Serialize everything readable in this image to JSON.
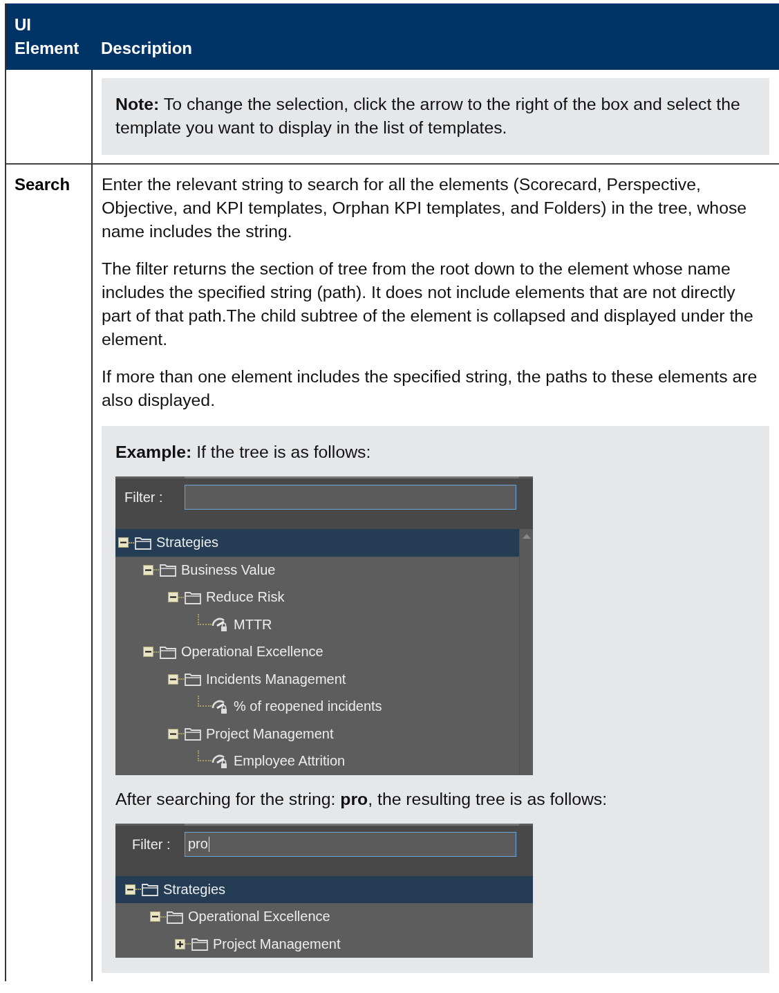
{
  "table": {
    "columns": [
      "UI Element",
      "Description"
    ],
    "rows": [
      {
        "blocks": [
          {
            "kind": "note",
            "text": "**Note:** To change the selection, click the arrow to the right of the box and select the template you want to display in the list of templates."
          }
        ]
      },
      {
        "element": "Search",
        "blocks": [
          {
            "kind": "paragraph",
            "text": "Enter the relevant string to search for all the elements (Scorecard, Perspective, Objective, and KPI templates, Orphan KPI templates, and Folders) in the tree, whose name includes the string."
          },
          {
            "kind": "paragraph",
            "text": "The filter returns the section of tree from the root down to the element whose name includes the specified string (path). It does not include elements that are not directly part of that path.The child subtree of the element is collapsed and displayed under the element."
          },
          {
            "kind": "paragraph",
            "text": "If more than one element includes the specified string, the paths to these elements are also displayed."
          },
          {
            "kind": "example",
            "parts": [
              {
                "kind": "text",
                "text": "**Example:** If the tree is as follows:"
              },
              {
                "kind": "tree",
                "filter_label": "Filter :",
                "scrollbar": true,
                "nodes": [
                  {
                    "label": "Strategies",
                    "kind": "folder",
                    "expanded": true,
                    "selected": true,
                    "children": [
                      {
                        "label": "Business Value",
                        "kind": "folder",
                        "expanded": true,
                        "selected": false,
                        "children": [
                          {
                            "label": "Reduce Risk",
                            "kind": "folder",
                            "expanded": true,
                            "selected": false,
                            "children": [
                              {
                                "label": "MTTR",
                                "kind": "kpi",
                                "selected": false
                              }
                            ]
                          }
                        ]
                      },
                      {
                        "label": "Operational Excellence",
                        "kind": "folder",
                        "expanded": true,
                        "selected": false,
                        "children": [
                          {
                            "label": "Incidents Management",
                            "kind": "folder",
                            "expanded": true,
                            "selected": false,
                            "children": [
                              {
                                "label": "% of reopened incidents",
                                "kind": "kpi",
                                "selected": false
                              }
                            ]
                          },
                          {
                            "label": "Project Management",
                            "kind": "folder",
                            "expanded": true,
                            "selected": false,
                            "children": [
                              {
                                "label": "Employee Attrition",
                                "kind": "kpi",
                                "selected": false
                              }
                            ]
                          }
                        ]
                      }
                    ]
                  }
                ]
              },
              {
                "kind": "text",
                "text": "After searching for the string: **pro**, the resulting tree is as follows:"
              },
              {
                "kind": "tree",
                "filter_label": "Filter :",
                "filter_value": "pro",
                "scrollbar": false,
                "nodes": [
                  {
                    "label": "Strategies",
                    "kind": "folder",
                    "expanded": true,
                    "selected": true,
                    "children": [
                      {
                        "label": "Operational Excellence",
                        "kind": "folder",
                        "expanded": true,
                        "selected": false,
                        "children": [
                          {
                            "label": "Project Management",
                            "kind": "folder",
                            "expanded": false,
                            "selected": false
                          }
                        ]
                      }
                    ]
                  }
                ]
              }
            ]
          }
        ]
      }
    ]
  }
}
